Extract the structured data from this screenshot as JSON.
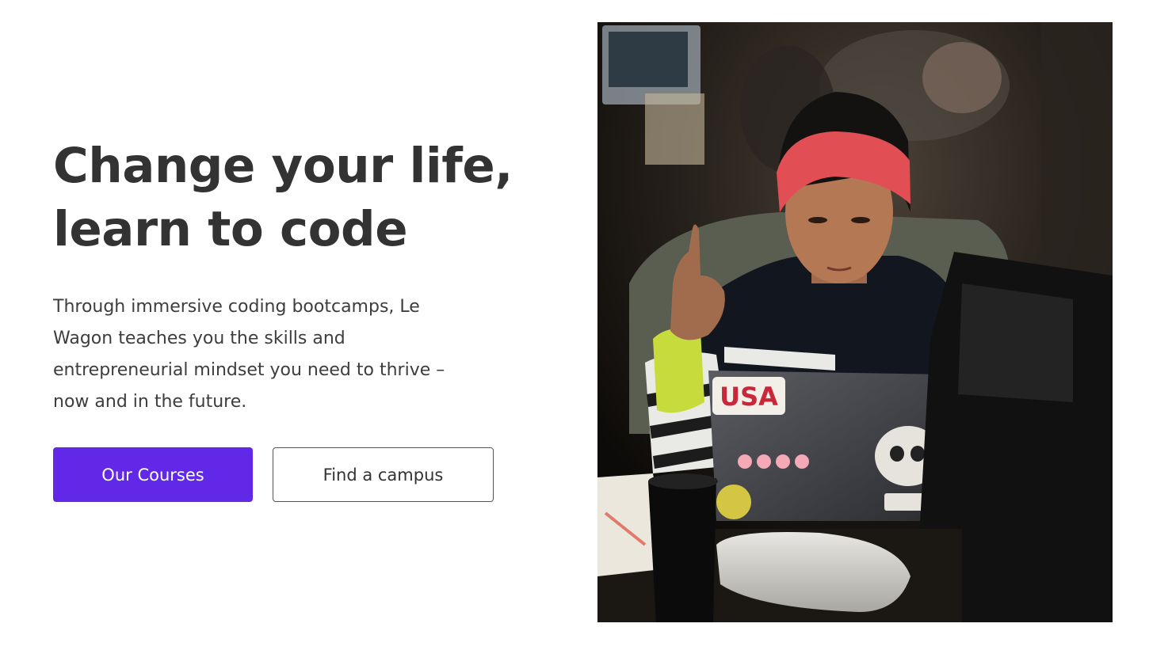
{
  "hero": {
    "headline_lines": [
      "Change your life,",
      "learn to code"
    ],
    "subtext_lines": [
      "Through immersive coding bootcamps, Le",
      "Wagon teaches you the skills and",
      "entrepreneurial mindset you need to thrive –",
      "now and in the future."
    ]
  },
  "buttons": {
    "primary_label": "Our Courses",
    "secondary_label": "Find a campus"
  },
  "image": {
    "alt_label": "Student coding on a laptop",
    "sticker_text": "USA"
  },
  "colors": {
    "accent": "#6228e8",
    "heading": "#333333",
    "body_text": "#3d3d3d"
  }
}
